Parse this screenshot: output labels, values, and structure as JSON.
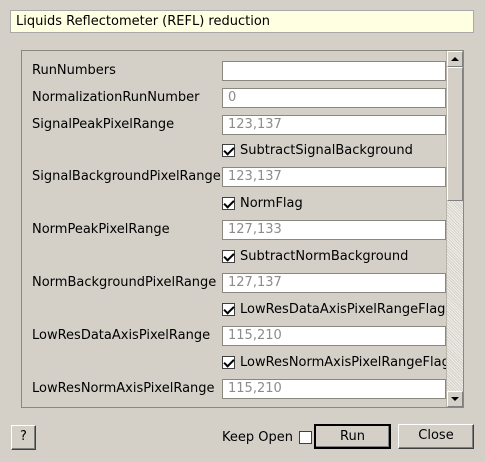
{
  "dialog": {
    "title": "Liquids Reflectometer (REFL) reduction"
  },
  "form": {
    "rows": [
      {
        "type": "text",
        "label": "RunNumbers",
        "value": "",
        "placeholder": ""
      },
      {
        "type": "text",
        "label": "NormalizationRunNumber",
        "value": "",
        "placeholder": "0"
      },
      {
        "type": "text",
        "label": "SignalPeakPixelRange",
        "value": "",
        "placeholder": "123,137"
      },
      {
        "type": "check",
        "label": "SubtractSignalBackground",
        "checked": true
      },
      {
        "type": "text",
        "label": "SignalBackgroundPixelRange",
        "value": "",
        "placeholder": "123,137"
      },
      {
        "type": "check",
        "label": "NormFlag",
        "checked": true
      },
      {
        "type": "text",
        "label": "NormPeakPixelRange",
        "value": "",
        "placeholder": "127,133"
      },
      {
        "type": "check",
        "label": "SubtractNormBackground",
        "checked": true
      },
      {
        "type": "text",
        "label": "NormBackgroundPixelRange",
        "value": "",
        "placeholder": "127,137"
      },
      {
        "type": "check",
        "label": "LowResDataAxisPixelRangeFlag",
        "checked": true
      },
      {
        "type": "text",
        "label": "LowResDataAxisPixelRange",
        "value": "",
        "placeholder": "115,210"
      },
      {
        "type": "check",
        "label": "LowResNormAxisPixelRangeFlag",
        "checked": true
      },
      {
        "type": "text",
        "label": "LowResNormAxisPixelRange",
        "value": "",
        "placeholder": "115,210"
      }
    ]
  },
  "footer": {
    "help_label": "?",
    "keep_open_label": "Keep Open",
    "keep_open_checked": false,
    "run_label": "Run",
    "close_label": "Close"
  }
}
